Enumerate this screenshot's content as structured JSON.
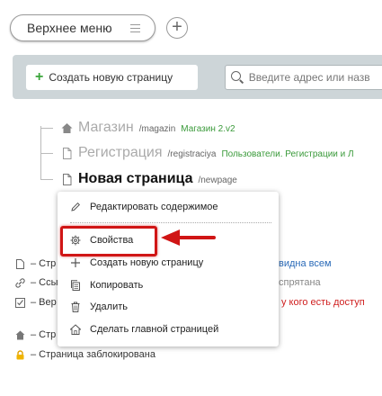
{
  "top_menu": {
    "tab_label": "Верхнее меню",
    "add_label": "+"
  },
  "toolbar": {
    "create_label": "Создать новую страницу",
    "search_placeholder": "Введите адрес или назв"
  },
  "pages": [
    {
      "title": "Магазин",
      "path": "/magazin",
      "template": "Магазин 2.v2",
      "icon": "home-icon"
    },
    {
      "title": "Регистрация",
      "path": "/registraciya",
      "template": "Пользователи. Регистрации и Л",
      "icon": "page-icon"
    },
    {
      "title": "Новая страница",
      "path": "/newpage",
      "template": "",
      "icon": "page-icon"
    }
  ],
  "legend": [
    {
      "prefix": "– Стр",
      "suffix": "видна всем",
      "suffix_color": "#2a6ab8"
    },
    {
      "prefix": "– Ссы",
      "suffix": "спрятана",
      "suffix_color": "#888888"
    },
    {
      "prefix": "– Вер",
      "suffix": "у кого есть доступ",
      "suffix_color": "#d02020"
    },
    {
      "prefix": "– Стр",
      "suffix": "",
      "suffix_color": "#333333"
    },
    {
      "prefix": "– Страница заблокирована",
      "suffix": "",
      "suffix_color": "#333333"
    }
  ],
  "context_menu": {
    "edit": "Редактировать содержимое",
    "properties": "Свойства",
    "create": "Создать новую страницу",
    "copy": "Копировать",
    "delete": "Удалить",
    "make_home": "Сделать главной страницей"
  },
  "colors": {
    "accent_green": "#3aa53a",
    "highlight_red": "#d01515",
    "toolbar_bg": "#cdd5d8"
  }
}
